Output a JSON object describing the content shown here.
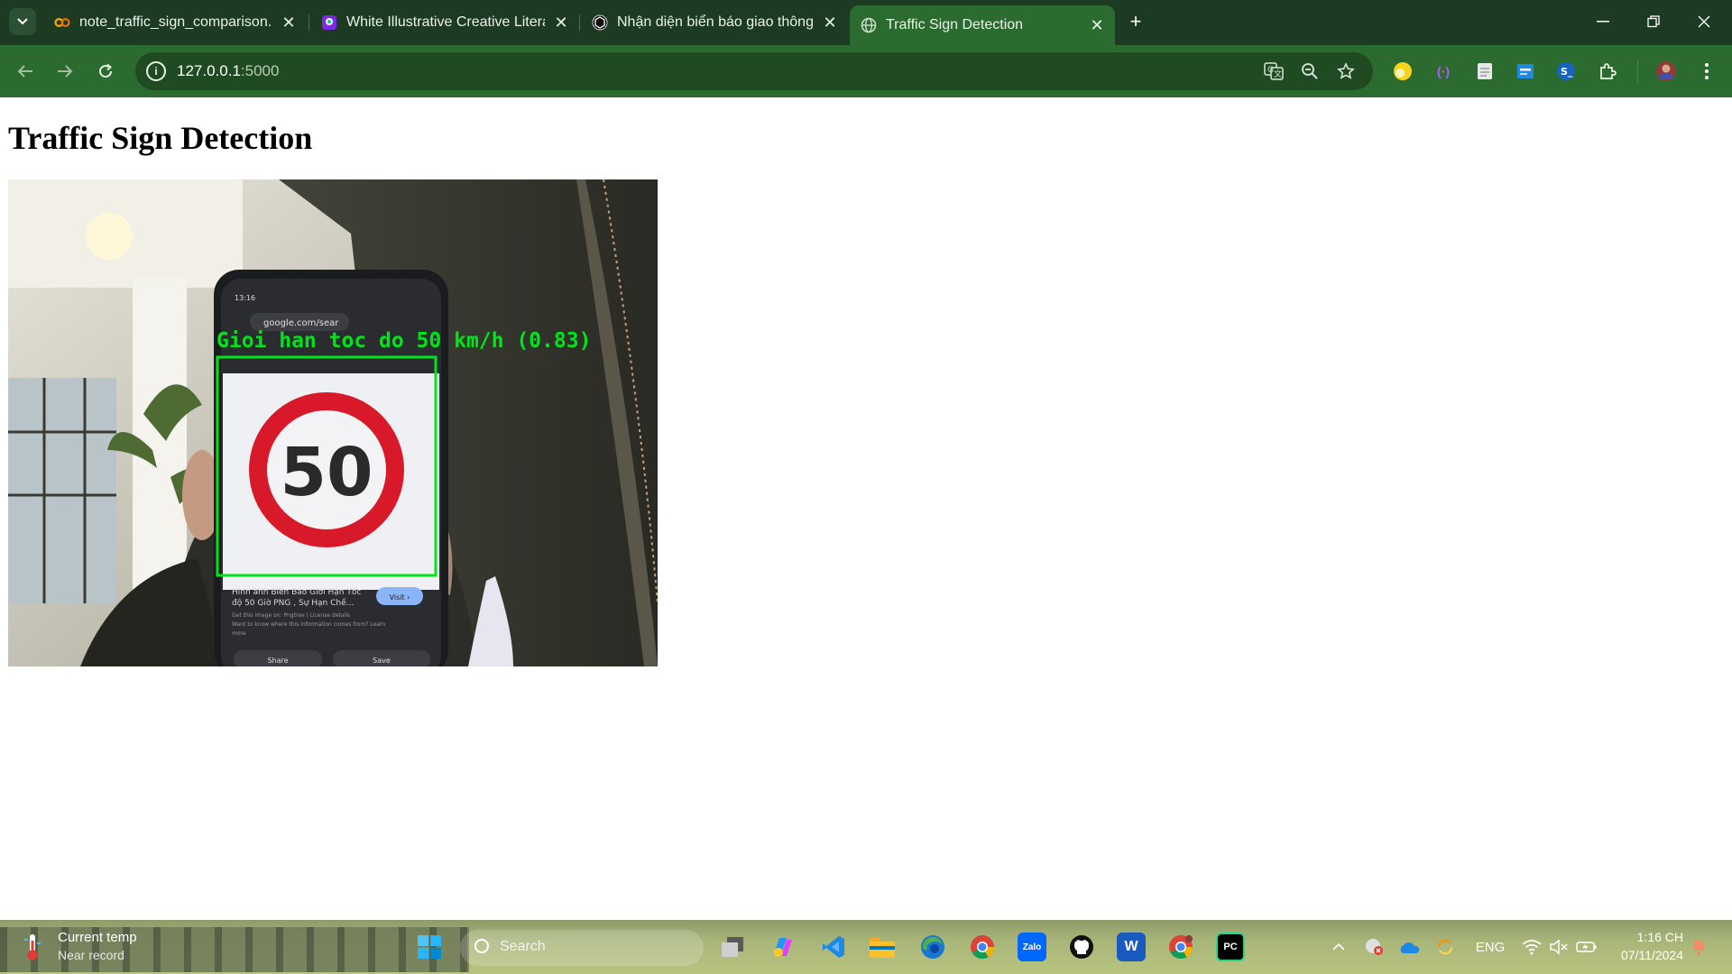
{
  "browser": {
    "tabs": [
      {
        "title": "note_traffic_sign_comparison.ip",
        "favicon": "colab-icon",
        "active": false
      },
      {
        "title": "White Illustrative Creative Litera",
        "favicon": "canva-icon",
        "active": false
      },
      {
        "title": "Nhận diện biển báo giao thông",
        "favicon": "chatgpt-icon",
        "active": false
      },
      {
        "title": "Traffic Sign Detection",
        "favicon": "globe-icon",
        "active": true
      }
    ],
    "address": {
      "host": "127.0.0.1",
      "port": ":5000"
    },
    "extensions": [
      "yellow-circle-extension-icon",
      "purple-brackets-extension-icon",
      "document-extension-icon",
      "id-card-extension-icon",
      "blue-s-extension-icon",
      "puzzle-extensions-icon",
      "profile-avatar",
      "more-menu-icon"
    ]
  },
  "page": {
    "title": "Traffic Sign Detection",
    "video": {
      "detection_label": "Gioi han toc do 50 km/h (0.83)",
      "sign_number": "50",
      "phone_caption_1": "Hình ảnh Biển Báo Giới Hạn Tốc",
      "phone_caption_2": "độ 50 Giờ PNG , Sự Hạn Chế...",
      "phone_caption_3": "Get this image on: Pngtree | License details",
      "phone_caption_4": "Want to know where this information comes from? Learn",
      "phone_caption_5": "more",
      "phone_visit": "Visit ›",
      "phone_url": "google.com/sear",
      "phone_time": "13:16",
      "phone_share": "Share",
      "phone_save": "Save",
      "box_color": "#00e51a"
    }
  },
  "taskbar": {
    "weather_line1": "Current temp",
    "weather_line2": "Near record",
    "search_label": "Search",
    "language": "ENG",
    "time": "1:16 CH",
    "date": "07/11/2024",
    "apps": [
      "windows-start-icon",
      "task-view-icon",
      "copilot-icon",
      "vscode-icon",
      "file-explorer-icon",
      "edge-icon",
      "chrome-icon",
      "zalo-icon",
      "github-icon",
      "word-icon",
      "chrome-profile-icon",
      "pycharm-icon"
    ]
  }
}
